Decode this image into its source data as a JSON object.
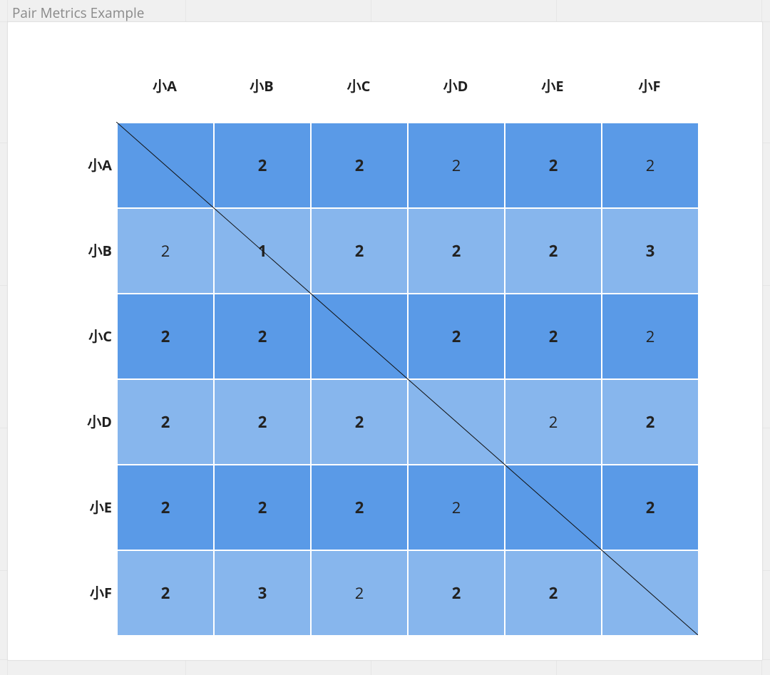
{
  "title": "Pair Metrics Example",
  "labels": [
    "小A",
    "小B",
    "小C",
    "小D",
    "小E",
    "小F"
  ],
  "cells": [
    [
      {
        "v": "",
        "b": false,
        "s": "dark"
      },
      {
        "v": "2",
        "b": true,
        "s": "dark"
      },
      {
        "v": "2",
        "b": true,
        "s": "dark"
      },
      {
        "v": "2",
        "b": false,
        "s": "dark"
      },
      {
        "v": "2",
        "b": true,
        "s": "dark"
      },
      {
        "v": "2",
        "b": false,
        "s": "dark"
      }
    ],
    [
      {
        "v": "2",
        "b": false,
        "s": "light"
      },
      {
        "v": "1",
        "b": true,
        "s": "light"
      },
      {
        "v": "2",
        "b": true,
        "s": "light"
      },
      {
        "v": "2",
        "b": true,
        "s": "light"
      },
      {
        "v": "2",
        "b": true,
        "s": "light"
      },
      {
        "v": "3",
        "b": true,
        "s": "light"
      }
    ],
    [
      {
        "v": "2",
        "b": true,
        "s": "dark"
      },
      {
        "v": "2",
        "b": true,
        "s": "dark"
      },
      {
        "v": "",
        "b": false,
        "s": "dark"
      },
      {
        "v": "2",
        "b": true,
        "s": "dark"
      },
      {
        "v": "2",
        "b": true,
        "s": "dark"
      },
      {
        "v": "2",
        "b": false,
        "s": "dark"
      }
    ],
    [
      {
        "v": "2",
        "b": true,
        "s": "light"
      },
      {
        "v": "2",
        "b": true,
        "s": "light"
      },
      {
        "v": "2",
        "b": true,
        "s": "light"
      },
      {
        "v": "",
        "b": false,
        "s": "light"
      },
      {
        "v": "2",
        "b": false,
        "s": "light"
      },
      {
        "v": "2",
        "b": true,
        "s": "light"
      }
    ],
    [
      {
        "v": "2",
        "b": true,
        "s": "dark"
      },
      {
        "v": "2",
        "b": true,
        "s": "dark"
      },
      {
        "v": "2",
        "b": true,
        "s": "dark"
      },
      {
        "v": "2",
        "b": false,
        "s": "dark"
      },
      {
        "v": "",
        "b": false,
        "s": "dark"
      },
      {
        "v": "2",
        "b": true,
        "s": "dark"
      }
    ],
    [
      {
        "v": "2",
        "b": true,
        "s": "light"
      },
      {
        "v": "3",
        "b": true,
        "s": "light"
      },
      {
        "v": "2",
        "b": false,
        "s": "light"
      },
      {
        "v": "2",
        "b": true,
        "s": "light"
      },
      {
        "v": "2",
        "b": true,
        "s": "light"
      },
      {
        "v": "",
        "b": false,
        "s": "light"
      }
    ]
  ],
  "colors": {
    "dark": "#5a9ae7",
    "light": "#87b6ed"
  },
  "chart_data": {
    "type": "heatmap",
    "title": "Pair Metrics Example",
    "row_labels": [
      "小A",
      "小B",
      "小C",
      "小D",
      "小E",
      "小F"
    ],
    "col_labels": [
      "小A",
      "小B",
      "小C",
      "小D",
      "小E",
      "小F"
    ],
    "values": [
      [
        null,
        2,
        2,
        2,
        2,
        2
      ],
      [
        2,
        1,
        2,
        2,
        2,
        3
      ],
      [
        2,
        2,
        null,
        2,
        2,
        2
      ],
      [
        2,
        2,
        2,
        null,
        2,
        2
      ],
      [
        2,
        2,
        2,
        2,
        null,
        2
      ],
      [
        2,
        3,
        2,
        2,
        2,
        null
      ]
    ],
    "bold_mask": [
      [
        false,
        true,
        true,
        false,
        true,
        false
      ],
      [
        false,
        true,
        true,
        true,
        true,
        true
      ],
      [
        true,
        true,
        false,
        true,
        true,
        false
      ],
      [
        true,
        true,
        true,
        false,
        false,
        true
      ],
      [
        true,
        true,
        true,
        false,
        false,
        true
      ],
      [
        true,
        true,
        false,
        true,
        true,
        false
      ]
    ],
    "row_shade": [
      "dark",
      "light",
      "dark",
      "light",
      "dark",
      "light"
    ],
    "diagonal_line": true
  }
}
